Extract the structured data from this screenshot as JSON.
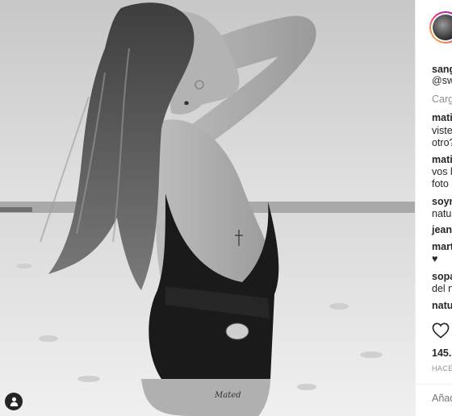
{
  "post": {
    "owner": "sang",
    "handle": "@sw",
    "loading_text": "Carg"
  },
  "comments": [
    {
      "lines": [
        "mati",
        "viste",
        "otro?"
      ],
      "bold_first": true
    },
    {
      "lines": [
        "mati",
        "vos h",
        "foto"
      ],
      "bold_first": true
    },
    {
      "lines": [
        "soym",
        "natu"
      ],
      "bold_first": true
    },
    {
      "lines": [
        "jeane"
      ],
      "bold_first": true
    },
    {
      "lines": [
        "mart",
        "♥"
      ],
      "bold_first": true
    },
    {
      "lines": [
        "sopa",
        "del n"
      ],
      "bold_first": true
    },
    {
      "lines": [
        "natu"
      ],
      "bold_first": true
    }
  ],
  "likes_text": "145.",
  "time_text": "HACE",
  "add_comment_placeholder": "Añad",
  "icons": {
    "like": "heart-icon",
    "tagged_users": "user-tag-icon",
    "avatar": "avatar"
  }
}
